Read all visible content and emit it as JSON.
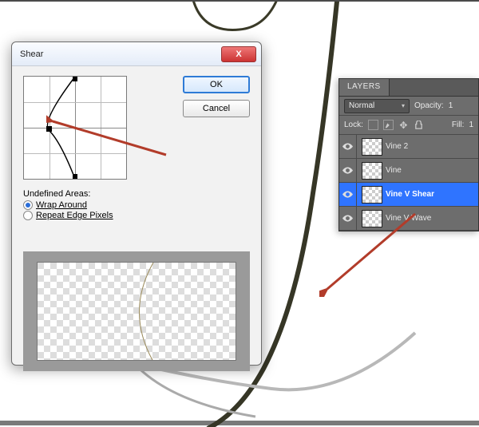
{
  "dialog": {
    "title": "Shear",
    "close_glyph": "X",
    "ok_label": "OK",
    "cancel_label": "Cancel",
    "undefined_areas_label": "Undefined Areas:",
    "wrap_label": "Wrap Around",
    "repeat_label": "Repeat Edge Pixels"
  },
  "panel": {
    "tab": "LAYERS",
    "blend_mode": "Normal",
    "opacity_label": "Opacity:",
    "opacity_value": "1",
    "lock_label": "Lock:",
    "fill_label": "Fill:",
    "fill_value": "1",
    "layers": [
      {
        "name": "Vine 2",
        "selected": false
      },
      {
        "name": "Vine",
        "selected": false
      },
      {
        "name": "Vine V Shear",
        "selected": true
      },
      {
        "name": "Vine V Wave",
        "selected": false
      }
    ]
  }
}
